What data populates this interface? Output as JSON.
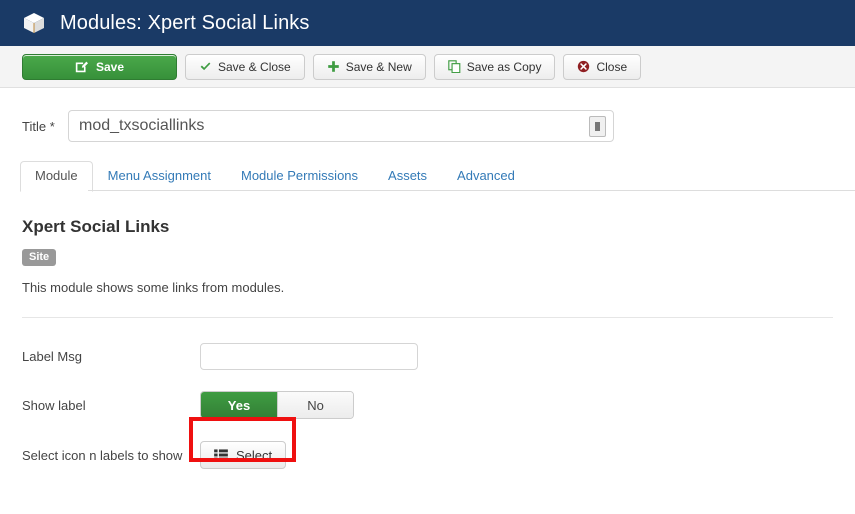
{
  "header": {
    "icon": "cube-icon",
    "title": "Modules: Xpert Social Links",
    "bg_color": "#1a3a66"
  },
  "toolbar": {
    "buttons": [
      {
        "label": "Save",
        "icon": "edit-square-icon",
        "style": "primary-green",
        "color": "#37913a"
      },
      {
        "label": "Save & Close",
        "icon": "check-icon",
        "style": "default",
        "color": "#3f9c42"
      },
      {
        "label": "Save & New",
        "icon": "plus-icon",
        "style": "default",
        "color": "#3f9c42"
      },
      {
        "label": "Save as Copy",
        "icon": "copy-icon",
        "style": "default",
        "color": "#3f9c42"
      },
      {
        "label": "Close",
        "icon": "close-circle-icon",
        "style": "default",
        "color": "#8f1f22"
      }
    ]
  },
  "title_field": {
    "label": "Title *",
    "value": "mod_txsociallinks",
    "placeholder": "",
    "trailing_icon": "device-icon"
  },
  "tabs": [
    {
      "label": "Module",
      "active": true
    },
    {
      "label": "Menu Assignment",
      "active": false
    },
    {
      "label": "Module Permissions",
      "active": false
    },
    {
      "label": "Assets",
      "active": false
    },
    {
      "label": "Advanced",
      "active": false
    }
  ],
  "panel": {
    "heading": "Xpert Social Links",
    "badge": "Site",
    "description": "This module shows some links from modules."
  },
  "form": {
    "label_msg": {
      "label": "Label Msg",
      "value": "",
      "placeholder": ""
    },
    "show_label": {
      "label": "Show label",
      "yes": "Yes",
      "no": "No",
      "selected": "Yes",
      "active_color": "#3f9c42"
    },
    "select_icons": {
      "label": "Select icon n labels to show",
      "button_label": "Select",
      "button_icon": "list-icon",
      "highlight_color": "#ef1010"
    }
  }
}
